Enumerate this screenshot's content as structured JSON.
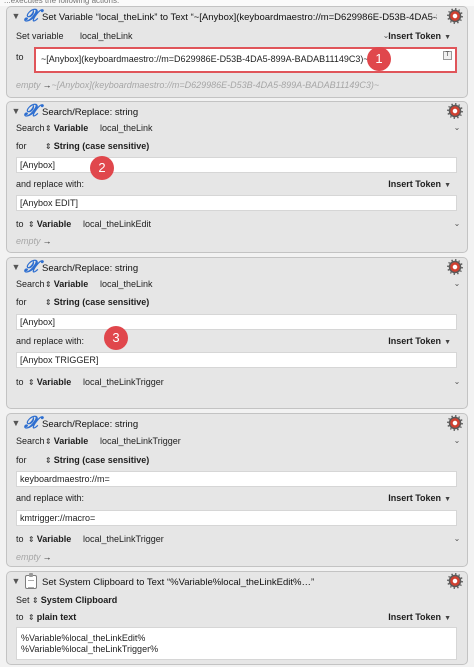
{
  "cut_text": "...executes the following actions:",
  "actions": [
    {
      "title": "Set Variable “local_theLink” to Text “~[Anybox](keyboardmaestro://m=D629986E-D53B-4DA5-8…”",
      "set_variable_label": "Set variable",
      "variable": "local_theLink",
      "insert_token": "Insert Token",
      "to_label": "to",
      "text_value": "~[Anybox](keyboardmaestro://m=D629986E-D53B-4DA5-899A-BADAB11149C3)~",
      "t_button": "T",
      "preview_prefix": "empty",
      "preview_arrow": "→",
      "preview_value": "~[Anybox](keyboardmaestro://m=D629986E-D53B-4DA5-899A-BADAB11149C3)~"
    },
    {
      "title": "Search/Replace: string",
      "search_label": "Search",
      "search_type": "Variable",
      "search_value": "local_theLink",
      "for_label": "for",
      "for_type": "String (case sensitive)",
      "for_value": "[Anybox]",
      "replace_label": "and replace with:",
      "insert_token": "Insert Token",
      "replace_value": "[Anybox EDIT]",
      "to_label": "to",
      "to_type": "Variable",
      "to_value": "local_theLinkEdit",
      "empty_label": "empty",
      "empty_arrow": "→"
    },
    {
      "title": "Search/Replace: string",
      "search_label": "Search",
      "search_type": "Variable",
      "search_value": "local_theLink",
      "for_label": "for",
      "for_type": "String (case sensitive)",
      "for_value": "[Anybox]",
      "replace_label": "and replace with:",
      "insert_token": "Insert Token",
      "replace_value": "[Anybox TRIGGER]",
      "to_label": "to",
      "to_type": "Variable",
      "to_value": "local_theLinkTrigger"
    },
    {
      "title": "Search/Replace: string",
      "search_label": "Search",
      "search_type": "Variable",
      "search_value": "local_theLinkTrigger",
      "for_label": "for",
      "for_type": "String (case sensitive)",
      "for_value": "keyboardmaestro://m=",
      "replace_label": "and replace with:",
      "insert_token": "Insert Token",
      "replace_value": "kmtrigger://macro=",
      "to_label": "to",
      "to_type": "Variable",
      "to_value": "local_theLinkTrigger",
      "empty_label": "empty",
      "empty_arrow": "→"
    },
    {
      "title": "Set System Clipboard to Text “%Variable%local_theLinkEdit%…”",
      "set_label": "Set",
      "set_value": "System Clipboard",
      "to_label": "to",
      "to_value": "plain text",
      "insert_token": "Insert Token",
      "text_line_1": "%Variable%local_theLinkEdit%",
      "text_line_2": "%Variable%local_theLinkTrigger%"
    }
  ],
  "callouts": [
    "1",
    "2",
    "3"
  ],
  "icons": {
    "collapse": "chevron-down-icon",
    "action": "variable-x-icon",
    "clipboard": "clipboard-icon",
    "gear": "gear-icon",
    "popup": "updown-chevron-icon",
    "token": "chevron-down-icon"
  },
  "colors": {
    "accent": "#2f6fd0",
    "highlight": "#e0555a",
    "badge": "#e0474c"
  }
}
